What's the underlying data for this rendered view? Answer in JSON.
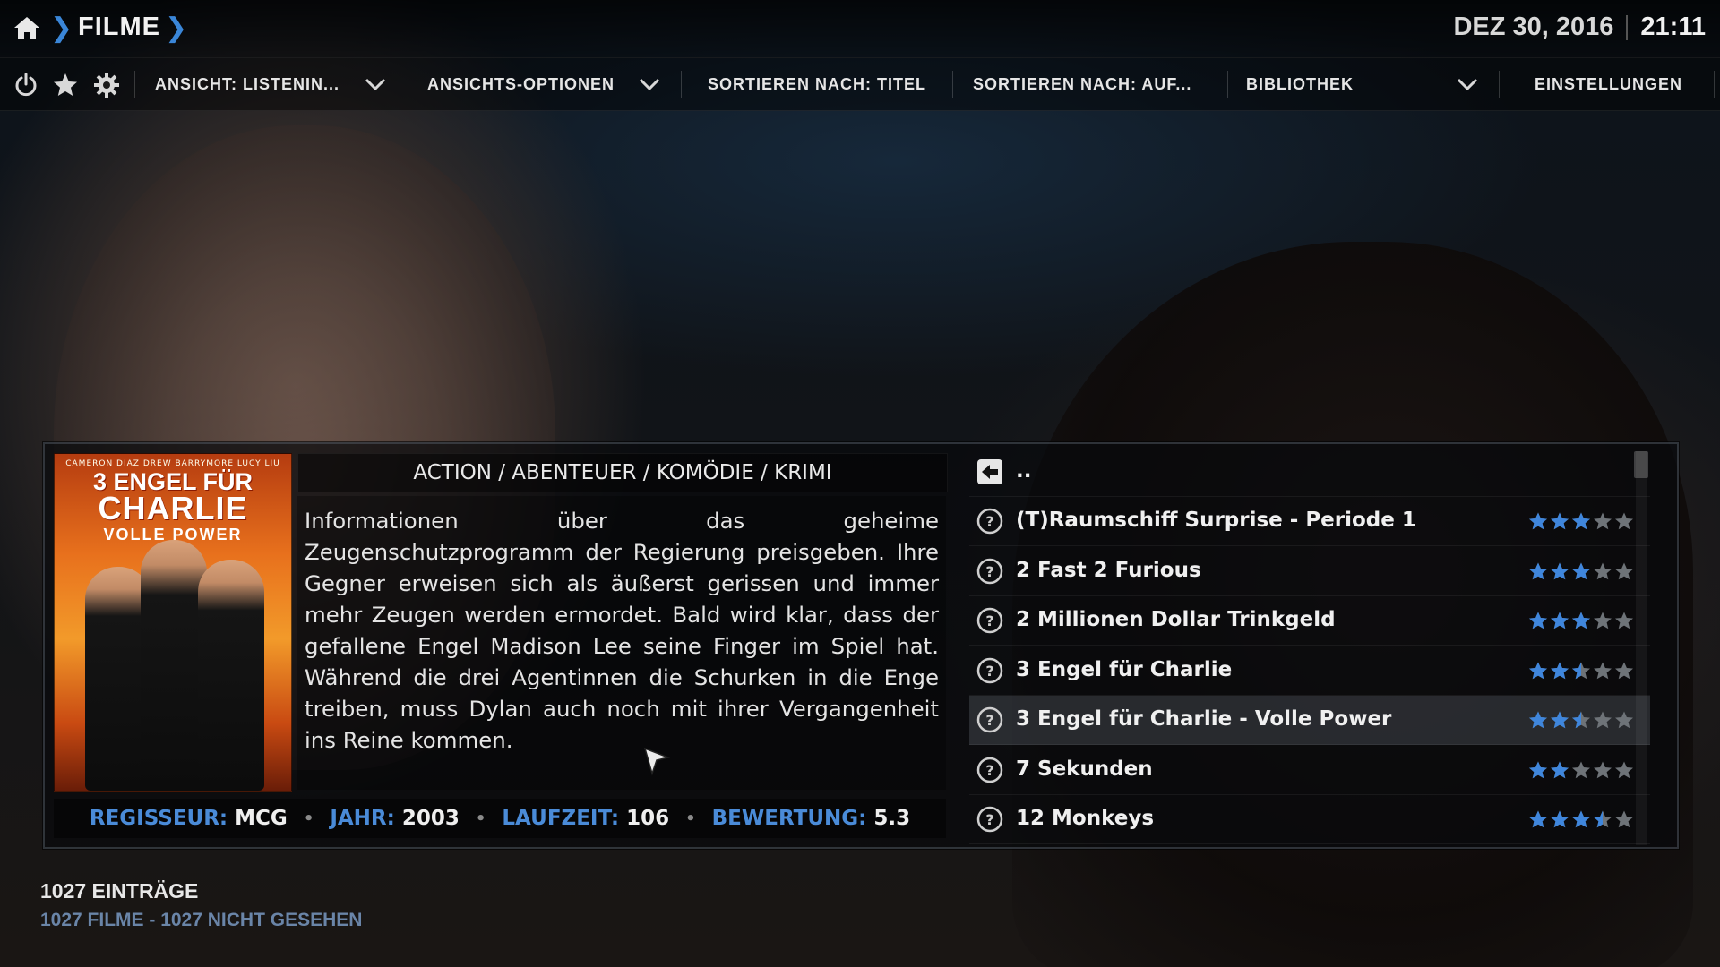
{
  "header": {
    "section_title": "FILME",
    "date": "DEZ 30, 2016",
    "time": "21:11"
  },
  "options_bar": {
    "view_label": "ANSICHT: LISTENIN...",
    "view_options_label": "ANSICHTS-OPTIONEN",
    "sort_by_label": "SORTIEREN NACH: TITEL",
    "sort_order_label": "SORTIEREN NACH: AUF...",
    "library_label": "BIBLIOTHEK",
    "settings_label": "EINSTELLUNGEN"
  },
  "details": {
    "poster_top_text": "CAMERON DIAZ  DREW BARRYMORE  LUCY LIU",
    "poster_title_line1": "3 ENGEL FÜR",
    "poster_title_line2": "CHARLIE",
    "poster_title_line3": "VOLLE POWER",
    "genres": "ACTION / ABENTEUER / KOMÖDIE / KRIMI",
    "plot": "Informationen über das geheime Zeugenschutzprogramm der Regierung preisgeben. Ihre Gegner erweisen sich als äußerst gerissen und immer mehr Zeugen werden ermordet. Bald wird klar, dass der gefallene Engel Madison Lee seine Finger im Spiel hat. Während die drei Agentinnen die Schurken in die Enge treiben, muss Dylan auch noch mit ihrer Vergangenheit ins Reine kommen.",
    "meta": {
      "director_label": "REGISSEUR:",
      "director_value": "MCG",
      "year_label": "JAHR:",
      "year_value": "2003",
      "runtime_label": "LAUFZEIT:",
      "runtime_value": "106",
      "rating_label": "BEWERTUNG:",
      "rating_value": "5.3"
    }
  },
  "list": {
    "parent_label": "..",
    "selected_index": 4,
    "items": [
      {
        "title": "(T)Raumschiff Surprise - Periode 1",
        "stars": 3
      },
      {
        "title": "2 Fast 2 Furious",
        "stars": 3
      },
      {
        "title": "2 Millionen Dollar Trinkgeld",
        "stars": 3
      },
      {
        "title": "3 Engel für Charlie",
        "stars": 2.5
      },
      {
        "title": "3 Engel für Charlie - Volle Power",
        "stars": 2.5
      },
      {
        "title": "7 Sekunden",
        "stars": 2
      },
      {
        "title": "12 Monkeys",
        "stars": 3.5
      }
    ]
  },
  "footer": {
    "count": "1027 EINTRÄGE",
    "summary": "1027 FILME  -  1027 NICHT GESEHEN"
  },
  "colors": {
    "accent": "#3a86d8",
    "meta_key": "#4a8bd8",
    "star_on": "#3f86dc",
    "star_off": "#6e7378"
  }
}
